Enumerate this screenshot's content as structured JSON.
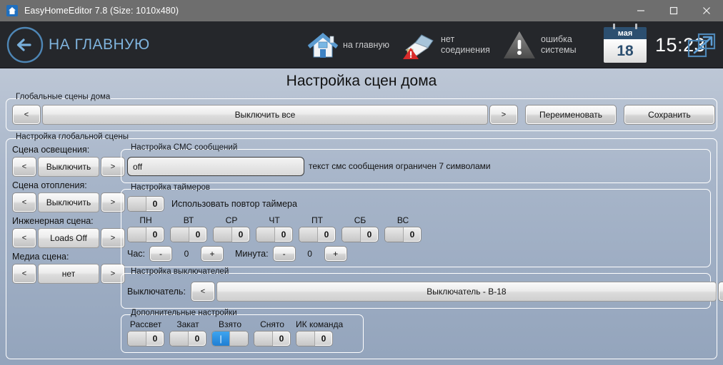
{
  "window": {
    "title": "EasyHomeEditor 7.8 (Size: 1010x480)",
    "app_icon": "home-app-icon",
    "minimize_label": "—",
    "maximize_label": "□",
    "close_label": "✕"
  },
  "header": {
    "back_label": "НА ГЛАВНУЮ",
    "back_icon": "back-arrow-circle-icon",
    "status": [
      {
        "icon": "house-icon",
        "label": "на главную"
      },
      {
        "icon": "plug-error-icon",
        "label": "нет соединения"
      },
      {
        "icon": "warning-triangle-icon",
        "label": "ошибка системы"
      }
    ],
    "calendar": {
      "month": "мая",
      "day": "18"
    },
    "clock": "15:23",
    "exit_icon": "external-link-exit-icon"
  },
  "page": {
    "title": "Настройка сцен дома"
  },
  "global_scenes": {
    "legend": "Глобальные сцены дома",
    "prev": "<",
    "value": "Выключить все",
    "next": ">",
    "rename": "Переименовать",
    "save": "Сохранить"
  },
  "scene_settings": {
    "legend": "Настройка глобальной сцены",
    "rows": [
      {
        "label": "Сцена освещения:",
        "prev": "<",
        "value": "Выключить",
        "next": ">"
      },
      {
        "label": "Сцена отопления:",
        "prev": "<",
        "value": "Выключить",
        "next": ">"
      },
      {
        "label": "Инженерная сцена:",
        "prev": "<",
        "value": "Loads Off",
        "next": ">"
      },
      {
        "label": "Медиа сцена:",
        "prev": "<",
        "value": "нет",
        "next": ">"
      }
    ]
  },
  "sms": {
    "legend": "Настройка СМС сообщений",
    "value": "off",
    "hint": "текст смс сообщения ограничен 7 символами"
  },
  "timers": {
    "legend": "Настройка таймеров",
    "repeat": {
      "value": "0",
      "state": "off",
      "label": "Использовать повтор таймера"
    },
    "weekdays": [
      {
        "name": "ПН",
        "value": "0",
        "state": "off"
      },
      {
        "name": "ВТ",
        "value": "0",
        "state": "off"
      },
      {
        "name": "СР",
        "value": "0",
        "state": "off"
      },
      {
        "name": "ЧТ",
        "value": "0",
        "state": "off"
      },
      {
        "name": "ПТ",
        "value": "0",
        "state": "off"
      },
      {
        "name": "СБ",
        "value": "0",
        "state": "off"
      },
      {
        "name": "ВС",
        "value": "0",
        "state": "off"
      }
    ],
    "hour": {
      "label": "Час:",
      "minus": "-",
      "value": "0",
      "plus": "+"
    },
    "minute": {
      "label": "Минута:",
      "minus": "-",
      "value": "0",
      "plus": "+"
    }
  },
  "switches": {
    "legend": "Настройка выключателей",
    "label": "Выключатель:",
    "prev": "<",
    "value": "Выключатель - В-18",
    "next": ">"
  },
  "extra": {
    "legend": "Дополнительные настройки",
    "items": [
      {
        "name": "Рассвет",
        "value": "0",
        "state": "off"
      },
      {
        "name": "Закат",
        "value": "0",
        "state": "off"
      },
      {
        "name": "Взято",
        "value": "|",
        "state": "on"
      },
      {
        "name": "Снято",
        "value": "0",
        "state": "off"
      },
      {
        "name": "ИК команда",
        "value": "0",
        "state": "off"
      }
    ]
  },
  "colors": {
    "titlebar": "#6e6e6e",
    "header": "#25272b",
    "accent_blue": "#7fb3dd",
    "panel_top": "#bdc7d6",
    "panel_bottom": "#93a4bc",
    "toggle_on": "#2f8fe0",
    "calendar_header": "#2c4f70"
  }
}
